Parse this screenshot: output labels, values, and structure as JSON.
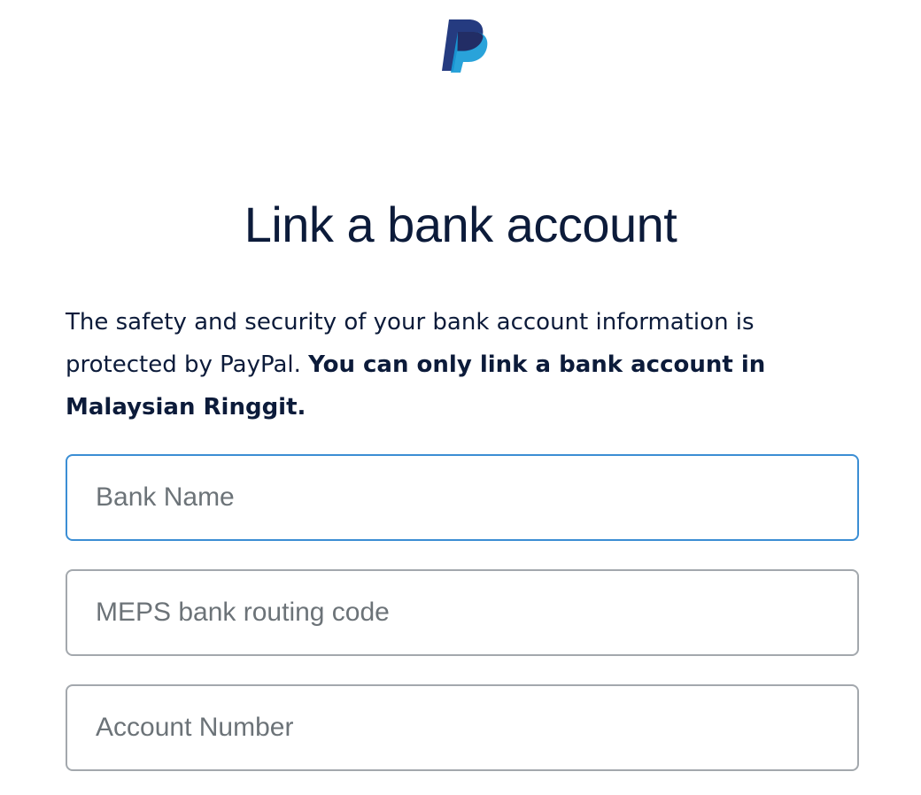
{
  "header": {
    "logo_icon": "paypal-logo-icon",
    "brand_colors": [
      "#253b80",
      "#179bd7",
      "#222d65"
    ]
  },
  "main": {
    "title": "Link a bank account",
    "description_plain": "The safety and security of your bank account information is protected by PayPal.",
    "description_bold": "You can only link a bank account in Malaysian Ringgit."
  },
  "form": {
    "bank_name": {
      "placeholder": "Bank Name",
      "value": ""
    },
    "meps_code": {
      "placeholder": "MEPS bank routing code",
      "value": ""
    },
    "account_number": {
      "placeholder": "Account Number",
      "value": ""
    }
  },
  "colors": {
    "text": "#0c1b3a",
    "focus_border": "#3b8ed4",
    "field_border": "#a3a8ad",
    "placeholder": "#6c7378"
  }
}
